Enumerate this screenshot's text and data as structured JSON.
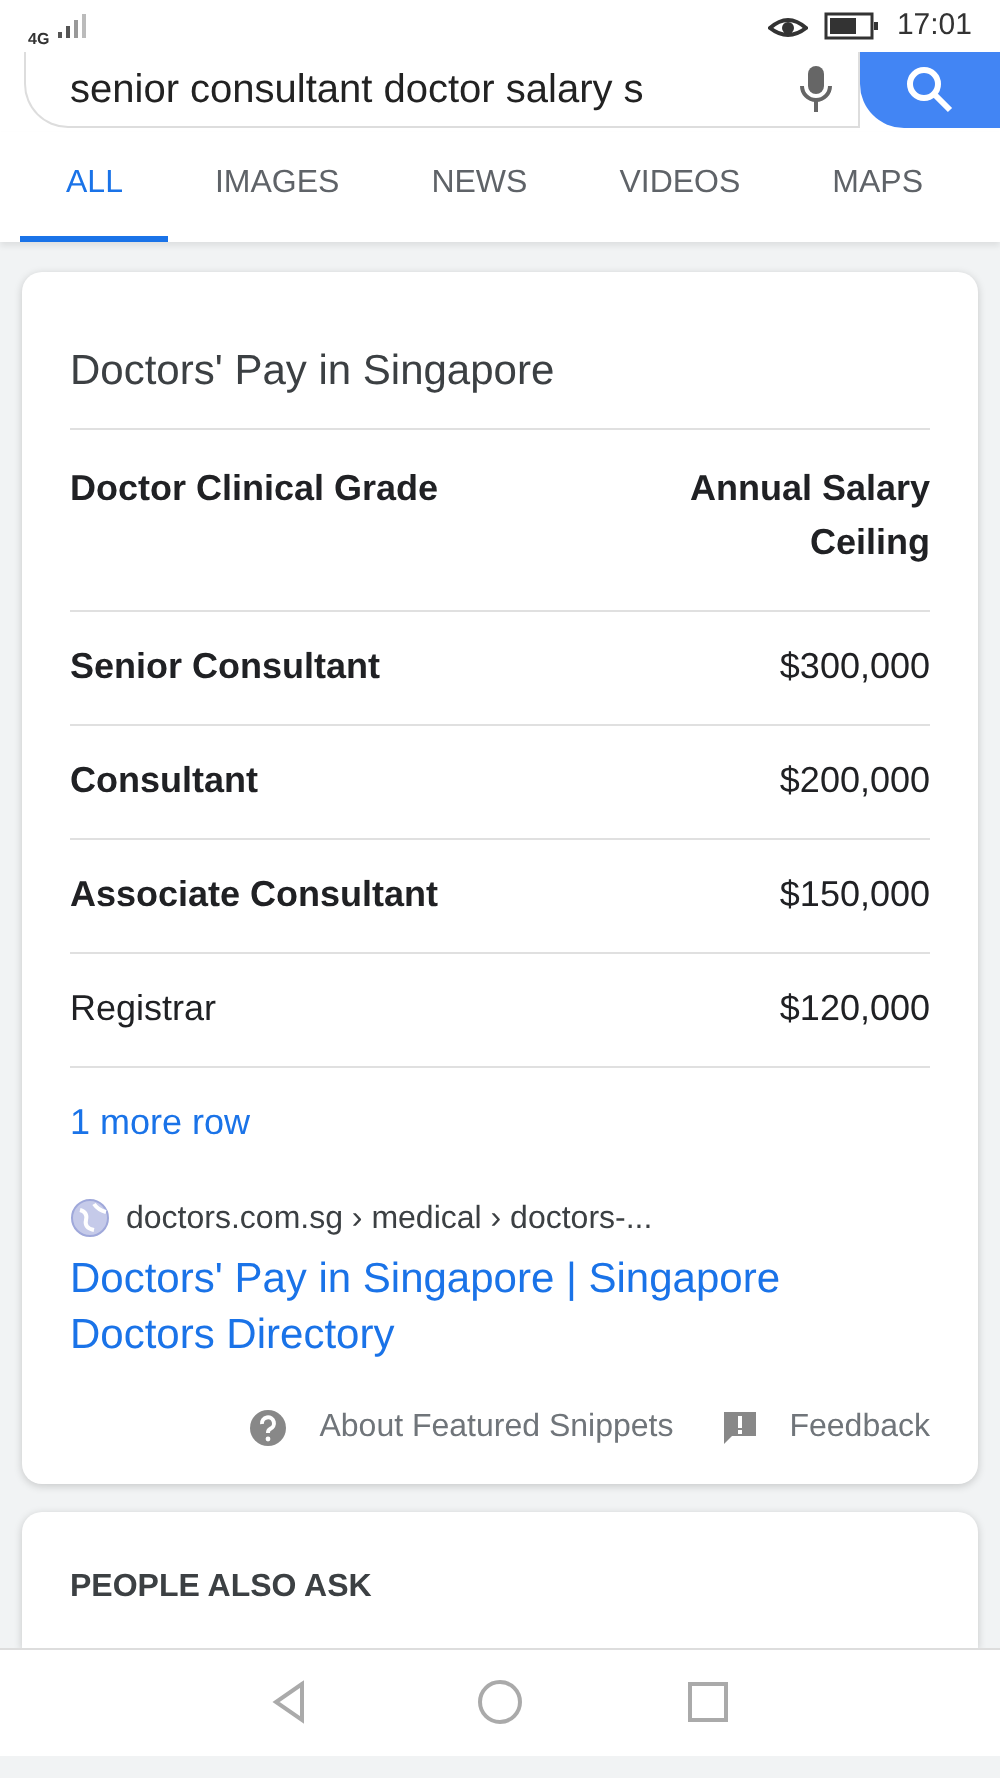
{
  "status_bar": {
    "network": "4G",
    "time": "17:01"
  },
  "search": {
    "value": "senior consultant doctor salary s"
  },
  "tabs": [
    {
      "label": "ALL",
      "selected": true
    },
    {
      "label": "IMAGES",
      "selected": false
    },
    {
      "label": "NEWS",
      "selected": false
    },
    {
      "label": "VIDEOS",
      "selected": false
    },
    {
      "label": "MAPS",
      "selected": false
    }
  ],
  "snippet": {
    "title": "Doctors' Pay in Singapore",
    "table": {
      "columns": [
        "Doctor Clinical Grade",
        "Annual Salary Ceiling"
      ],
      "rows": [
        {
          "grade": "Senior Consultant",
          "salary": "$300,000",
          "bold": true
        },
        {
          "grade": "Consultant",
          "salary": "$200,000",
          "bold": true
        },
        {
          "grade": "Associate Consultant",
          "salary": "$150,000",
          "bold": true
        },
        {
          "grade": "Registrar",
          "salary": "$120,000",
          "bold": false
        }
      ]
    },
    "more_rows": "1 more row",
    "source": "doctors.com.sg › medical › doctors-...",
    "link": "Doctors' Pay in Singapore | Singapore Doctors Directory",
    "about": "About Featured Snippets",
    "feedback": "Feedback"
  },
  "people_also_ask": {
    "title": "PEOPLE ALSO ASK"
  }
}
